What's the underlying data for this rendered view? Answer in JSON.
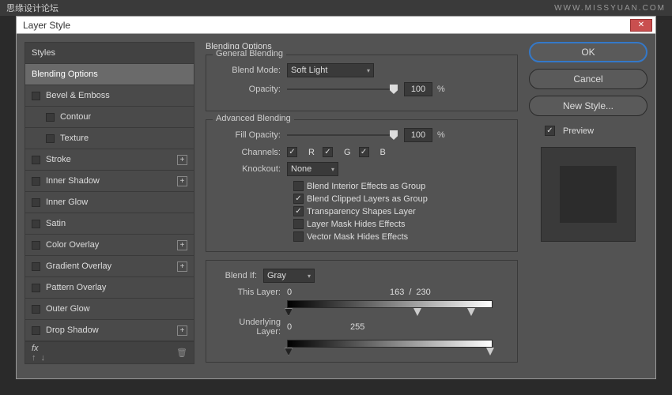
{
  "banner": {
    "left": "思缘设计论坛",
    "right": "WWW.MISSYUAN.COM"
  },
  "dialog": {
    "title": "Layer Style"
  },
  "sidebar": {
    "items": [
      {
        "label": "Styles",
        "header": true
      },
      {
        "label": "Blending Options",
        "selected": true
      },
      {
        "label": "Bevel & Emboss",
        "cb": true
      },
      {
        "label": "Contour",
        "cb": true,
        "sub": true
      },
      {
        "label": "Texture",
        "cb": true,
        "sub": true
      },
      {
        "label": "Stroke",
        "cb": true,
        "plus": true
      },
      {
        "label": "Inner Shadow",
        "cb": true,
        "plus": true
      },
      {
        "label": "Inner Glow",
        "cb": true
      },
      {
        "label": "Satin",
        "cb": true
      },
      {
        "label": "Color Overlay",
        "cb": true,
        "plus": true
      },
      {
        "label": "Gradient Overlay",
        "cb": true,
        "plus": true
      },
      {
        "label": "Pattern Overlay",
        "cb": true
      },
      {
        "label": "Outer Glow",
        "cb": true
      },
      {
        "label": "Drop Shadow",
        "cb": true,
        "plus": true
      }
    ],
    "fx": "fx"
  },
  "main": {
    "title": "Blending Options",
    "general": {
      "legend": "General Blending",
      "blend_mode_label": "Blend Mode:",
      "blend_mode_value": "Soft Light",
      "opacity_label": "Opacity:",
      "opacity_value": "100",
      "pct": "%"
    },
    "advanced": {
      "legend": "Advanced Blending",
      "fill_label": "Fill Opacity:",
      "fill_value": "100",
      "pct": "%",
      "channels_label": "Channels:",
      "r": "R",
      "g": "G",
      "b": "B",
      "knockout_label": "Knockout:",
      "knockout_value": "None",
      "opts": {
        "interior": "Blend Interior Effects as Group",
        "clipped": "Blend Clipped Layers as Group",
        "trans": "Transparency Shapes Layer",
        "layermask": "Layer Mask Hides Effects",
        "vectormask": "Vector Mask Hides Effects"
      }
    },
    "blendif": {
      "label": "Blend If:",
      "value": "Gray",
      "this_label": "This Layer:",
      "this_lo": "0",
      "this_hi1": "163",
      "slash": "/",
      "this_hi2": "230",
      "under_label": "Underlying Layer:",
      "under_lo": "0",
      "under_hi": "255"
    }
  },
  "right": {
    "ok": "OK",
    "cancel": "Cancel",
    "newstyle": "New Style...",
    "preview": "Preview"
  }
}
